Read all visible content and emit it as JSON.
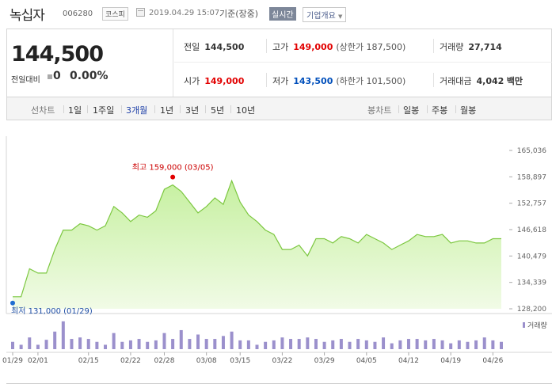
{
  "stock": {
    "name": "녹십자",
    "code": "006280",
    "market": "코스피",
    "timestamp": "2019.04.29 15:07",
    "timestamp_label": "기준(장중)",
    "live_badge": "실시간",
    "info_dropdown": "기업개요"
  },
  "quote": {
    "price": "144,500",
    "change_label": "전일대비",
    "change_value": "0",
    "change_pct": "0.00%",
    "prev_close_label": "전일",
    "prev_close": "144,500",
    "high_label": "고가",
    "high": "149,000",
    "upper_limit_label": "(상한가",
    "upper_limit": "187,500)",
    "volume_label": "거래량",
    "volume": "27,714",
    "open_label": "시가",
    "open": "149,000",
    "low_label": "저가",
    "low": "143,500",
    "lower_limit_label": "(하한가",
    "lower_limit": "101,500)",
    "amount_label": "거래대금",
    "amount": "4,042",
    "amount_unit": "백만"
  },
  "periods": {
    "line_label": "선차트",
    "line_items": [
      "1일",
      "1주일",
      "3개월",
      "1년",
      "3년",
      "5년",
      "10년"
    ],
    "active": "3개월",
    "candle_label": "봉차트",
    "candle_items": [
      "일봉",
      "주봉",
      "월봉"
    ]
  },
  "colors": {
    "up": "#e20000",
    "down": "#004fbb",
    "line": "#7cc740",
    "fill_top": "#c6f0a0",
    "fill_bottom": "#f1fbe6",
    "volume_bar": "#9b90cc",
    "active_tab": "#1c3ea7"
  },
  "chart_data": {
    "type": "area",
    "ylim": [
      128200,
      165036
    ],
    "y_ticks": [
      "165,036",
      "158,897",
      "152,757",
      "146,618",
      "140,479",
      "134,339",
      "128,200"
    ],
    "x_ticks": [
      "01/29",
      "02/01",
      "02/15",
      "02/22",
      "02/28",
      "03/08",
      "03/15",
      "03/22",
      "03/29",
      "04/05",
      "04/12",
      "04/19",
      "04/26"
    ],
    "x_tick_index": [
      0,
      3,
      9,
      14,
      18,
      23,
      27,
      32,
      37,
      42,
      47,
      52,
      57
    ],
    "annotation_high": "최고 159,000 (03/05)",
    "annotation_high_index": 19,
    "annotation_low": "최저 131,000 (01/29)",
    "annotation_low_index": 0,
    "volume_legend": "거래량",
    "price_series": [
      131000,
      131000,
      137500,
      136500,
      136500,
      142000,
      146500,
      146500,
      148000,
      147500,
      146500,
      147500,
      152000,
      150500,
      148500,
      150000,
      149500,
      151000,
      156000,
      157000,
      155500,
      153000,
      150500,
      152000,
      154000,
      152500,
      158000,
      153000,
      150000,
      148500,
      146500,
      145500,
      142000,
      142000,
      143000,
      140500,
      144500,
      144500,
      143500,
      145000,
      144500,
      143500,
      145500,
      144500,
      143500,
      142000,
      143000,
      144000,
      145500,
      145000,
      145000,
      145500,
      143500,
      144000,
      144000,
      143500,
      143500,
      144500,
      144500
    ],
    "volume_series": [
      0.25,
      0.15,
      0.4,
      0.15,
      0.32,
      0.6,
      0.95,
      0.35,
      0.4,
      0.35,
      0.25,
      0.15,
      0.55,
      0.25,
      0.3,
      0.35,
      0.25,
      0.3,
      0.55,
      0.35,
      0.65,
      0.35,
      0.5,
      0.35,
      0.35,
      0.45,
      0.6,
      0.3,
      0.3,
      0.15,
      0.25,
      0.3,
      0.4,
      0.35,
      0.35,
      0.4,
      0.35,
      0.25,
      0.3,
      0.35,
      0.25,
      0.35,
      0.3,
      0.25,
      0.4,
      0.2,
      0.3,
      0.35,
      0.35,
      0.3,
      0.35,
      0.3,
      0.2,
      0.3,
      0.25,
      0.3,
      0.4,
      0.3,
      0.25
    ]
  }
}
